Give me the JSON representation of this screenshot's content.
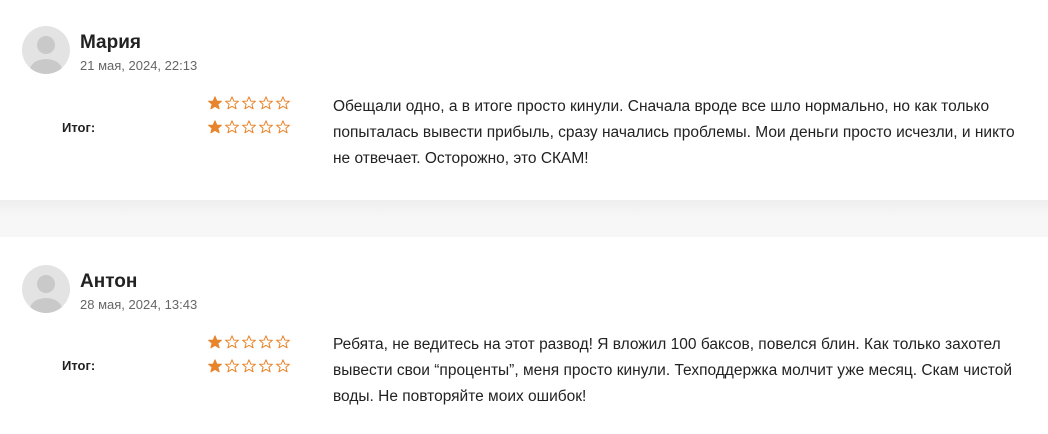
{
  "colors": {
    "star_filled": "#e8842c",
    "star_empty": "#e8842c",
    "separator": "#f4f4f4",
    "avatar_bg": "#e3e3e3"
  },
  "reviews": [
    {
      "author": "Мария",
      "date": "21 мая, 2024, 22:13",
      "total_label": "Итог:",
      "rating_row1": 1,
      "rating_row2": 1,
      "max_rating": 5,
      "text": "Обещали одно, а в итоге просто кинули. Сначала вроде все шло нормально, но как только попыталась вывести прибыль, сразу начались проблемы. Мои деньги просто исчезли, и никто не отвечает. Осторожно, это СКАМ!"
    },
    {
      "author": "Антон",
      "date": "28 мая, 2024, 13:43",
      "total_label": "Итог:",
      "rating_row1": 1,
      "rating_row2": 1,
      "max_rating": 5,
      "text": "Ребята, не ведитесь на этот развод! Я вложил 100 баксов, повелся блин. Как только захотел вывести свои “проценты”, меня просто кинули. Техподдержка молчит уже месяц. Скам чистой воды. Не повторяйте моих ошибок!"
    }
  ]
}
